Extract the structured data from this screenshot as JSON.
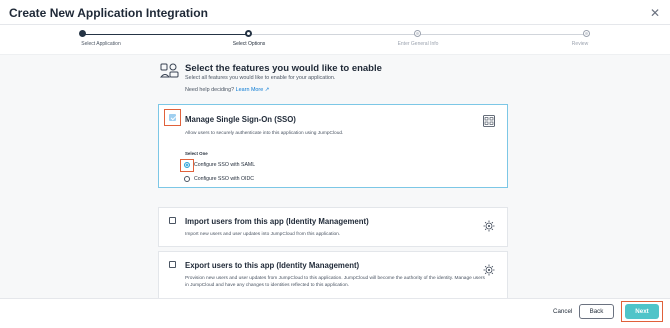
{
  "modal": {
    "title": "Create New Application Integration",
    "close_glyph": "✕"
  },
  "stepper": {
    "steps": [
      {
        "label": "Select Application",
        "state": "complete"
      },
      {
        "label": "Select Options",
        "state": "current"
      },
      {
        "label": "Enter General Info",
        "state": "upcoming"
      },
      {
        "label": "Review",
        "state": "upcoming"
      }
    ]
  },
  "intro": {
    "title": "Select the features you would like to enable",
    "subtitle": "Select all features you would like to enable for your application.",
    "help_prefix": "Need help deciding?",
    "help_link": "Learn More",
    "help_link_icon": "↗"
  },
  "features": [
    {
      "title": "Manage Single Sign-On (SSO)",
      "description": "Allow users to securely authenticate into this application using JumpCloud.",
      "checked": true,
      "icon": "sso-grid-icon",
      "select_one_label": "Select One",
      "options": [
        {
          "label": "Configure SSO with SAML",
          "selected": true
        },
        {
          "label": "Configure SSO with OIDC",
          "selected": false
        }
      ]
    },
    {
      "title": "Import users from this app (Identity Management)",
      "description": "Import new users and user updates into JumpCloud from this application.",
      "checked": false,
      "icon": "users-gear-icon"
    },
    {
      "title": "Export users to this app (Identity Management)",
      "description": "Provision new users and user updates from JumpCloud to this application. JumpCloud will become the authority of the identity. Manage users in JumpCloud and have any changes to identities reflected to this application.",
      "checked": false,
      "icon": "users-gear-icon"
    }
  ],
  "footer": {
    "cancel_label": "Cancel",
    "back_label": "Back",
    "next_label": "Next"
  },
  "colors": {
    "accent": "#4fc4c9",
    "link": "#0b7bd4",
    "highlight": "#e0613b",
    "stepper_done": "#253445"
  }
}
